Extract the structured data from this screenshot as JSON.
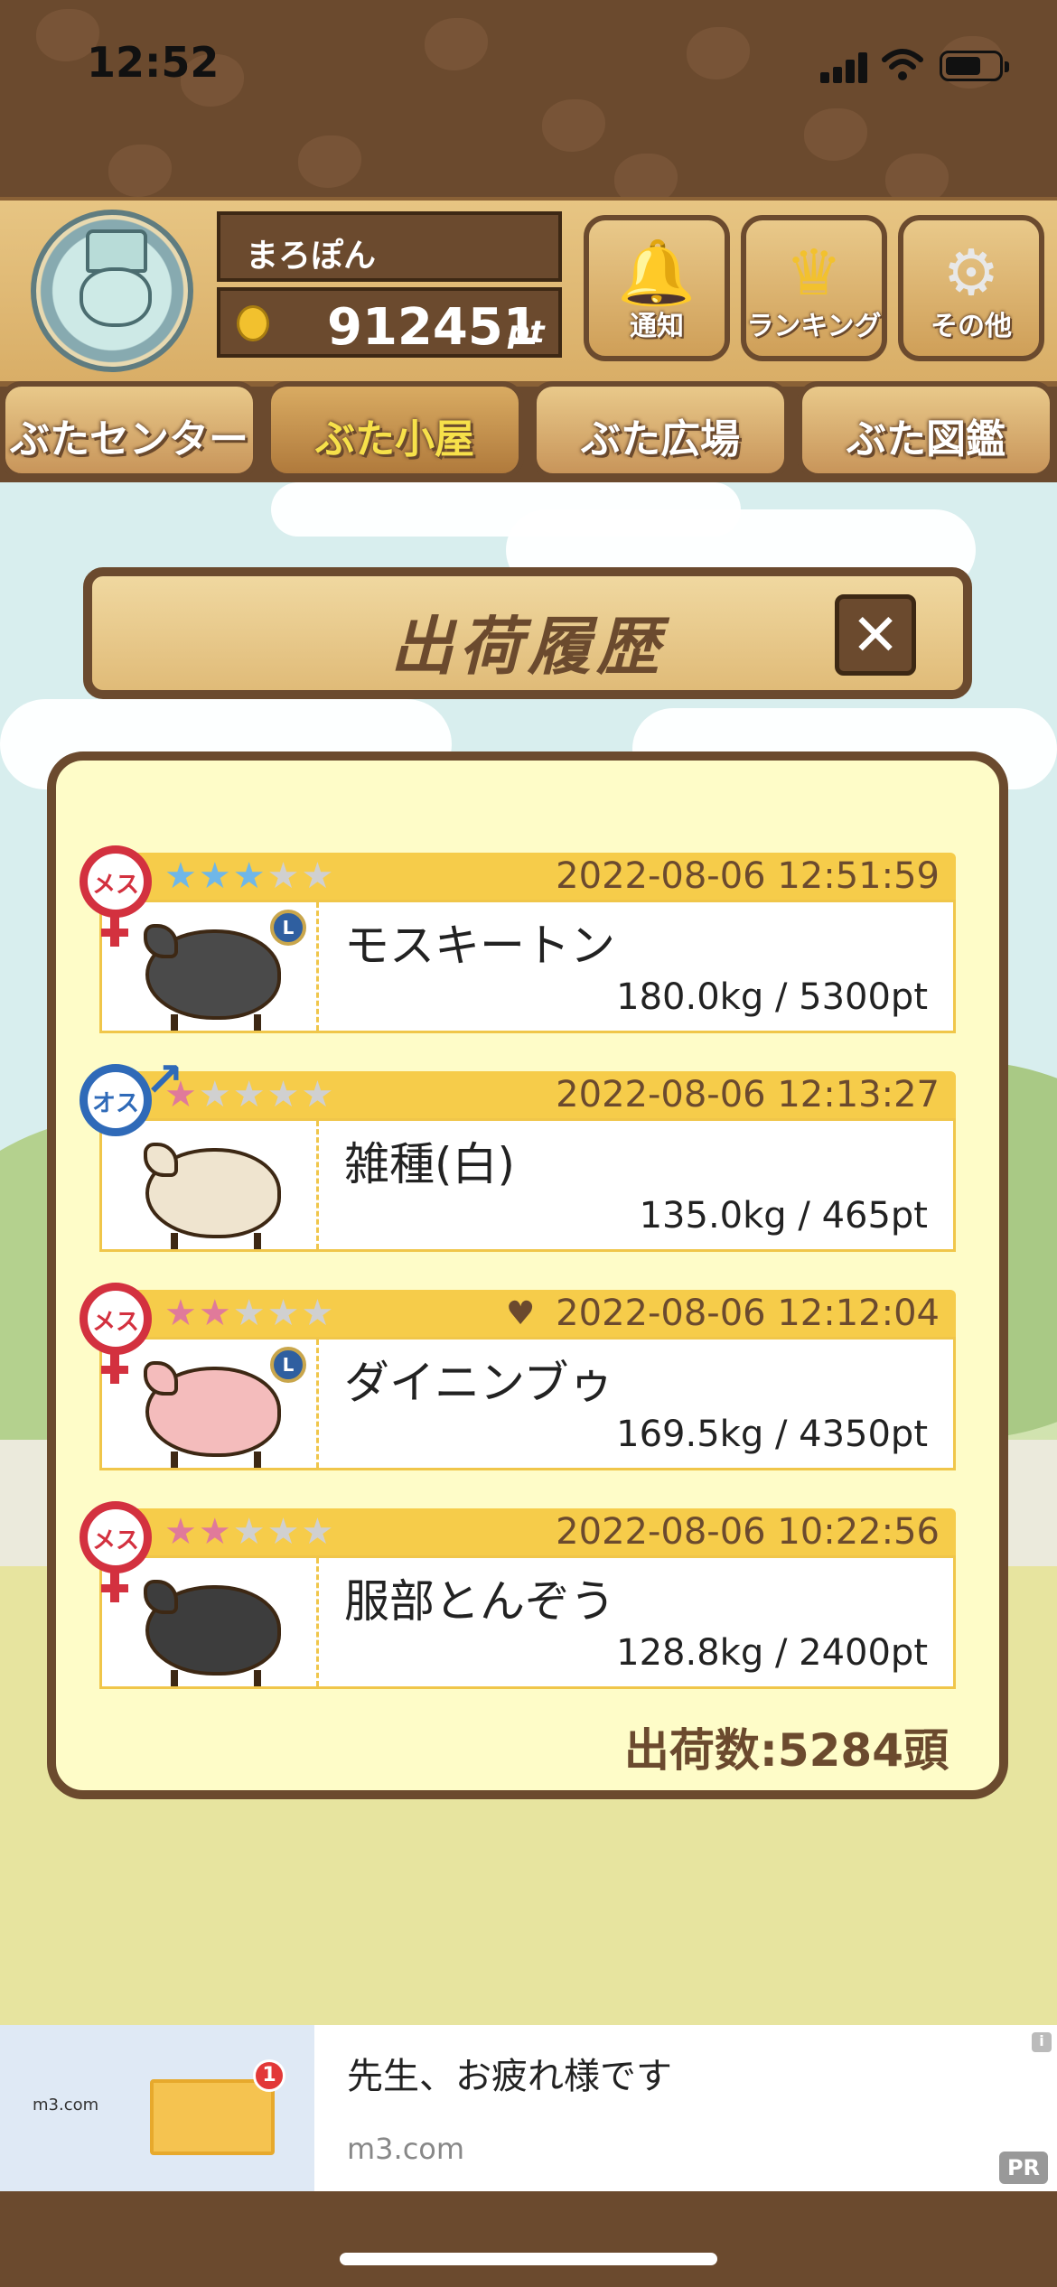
{
  "status_bar": {
    "time": "12:52"
  },
  "user": {
    "name": "まろぽん",
    "points": "912451",
    "points_unit": "pt"
  },
  "header_buttons": [
    {
      "label": "通知",
      "icon": "bell-icon"
    },
    {
      "label": "ランキング",
      "icon": "crown-icon"
    },
    {
      "label": "その他",
      "icon": "gear-icon"
    }
  ],
  "tabs": [
    {
      "label": "ぶたセンター"
    },
    {
      "label": "ぶた小屋",
      "active": true
    },
    {
      "label": "ぶた広場"
    },
    {
      "label": "ぶた図鑑"
    }
  ],
  "dialog": {
    "title": "出荷履歴",
    "close_label": "✕",
    "records": [
      {
        "gender_label": "メス",
        "gender": "female",
        "stars": 3,
        "star_color": "#6fb7e8",
        "has_heart": false,
        "has_ribbon": true,
        "ribbon_label": "L",
        "date": "2022-08-06 12:51:59",
        "name": "モスキートン",
        "weight_pt": "180.0kg / 5300pt",
        "pig_color": "#4a4a4a"
      },
      {
        "gender_label": "オス",
        "gender": "male",
        "stars": 1,
        "star_color": "#e07a9a",
        "has_heart": false,
        "has_ribbon": false,
        "date": "2022-08-06 12:13:27",
        "name": "雑種(白)",
        "weight_pt": "135.0kg / 465pt",
        "pig_color": "#efe4cf"
      },
      {
        "gender_label": "メス",
        "gender": "female",
        "stars": 2,
        "star_color": "#e07a9a",
        "has_heart": true,
        "has_ribbon": true,
        "ribbon_label": "L",
        "date": "2022-08-06 12:12:04",
        "name": "ダイニンブゥ",
        "weight_pt": "169.5kg / 4350pt",
        "pig_color": "#f4bcbc"
      },
      {
        "gender_label": "メス",
        "gender": "female",
        "stars": 2,
        "star_color": "#e07a9a",
        "has_heart": false,
        "has_ribbon": false,
        "date": "2022-08-06 10:22:56",
        "name": "服部とんぞう",
        "weight_pt": "128.8kg / 2400pt",
        "pig_color": "#3d3d3d"
      }
    ],
    "count_label": "出荷数:5284頭"
  },
  "ad": {
    "logo": "m3.com",
    "badge": "1",
    "title": "先生、お疲れ様です",
    "domain": "m3.com",
    "pr_label": "PR",
    "info_label": "i"
  },
  "colors": {
    "wood_dark": "#6b4a2e",
    "wood_light": "#e7c583",
    "panel_bg": "#fefcc8",
    "row_header": "#f6cc4a",
    "female": "#d3313f",
    "male": "#2f6ab8"
  }
}
